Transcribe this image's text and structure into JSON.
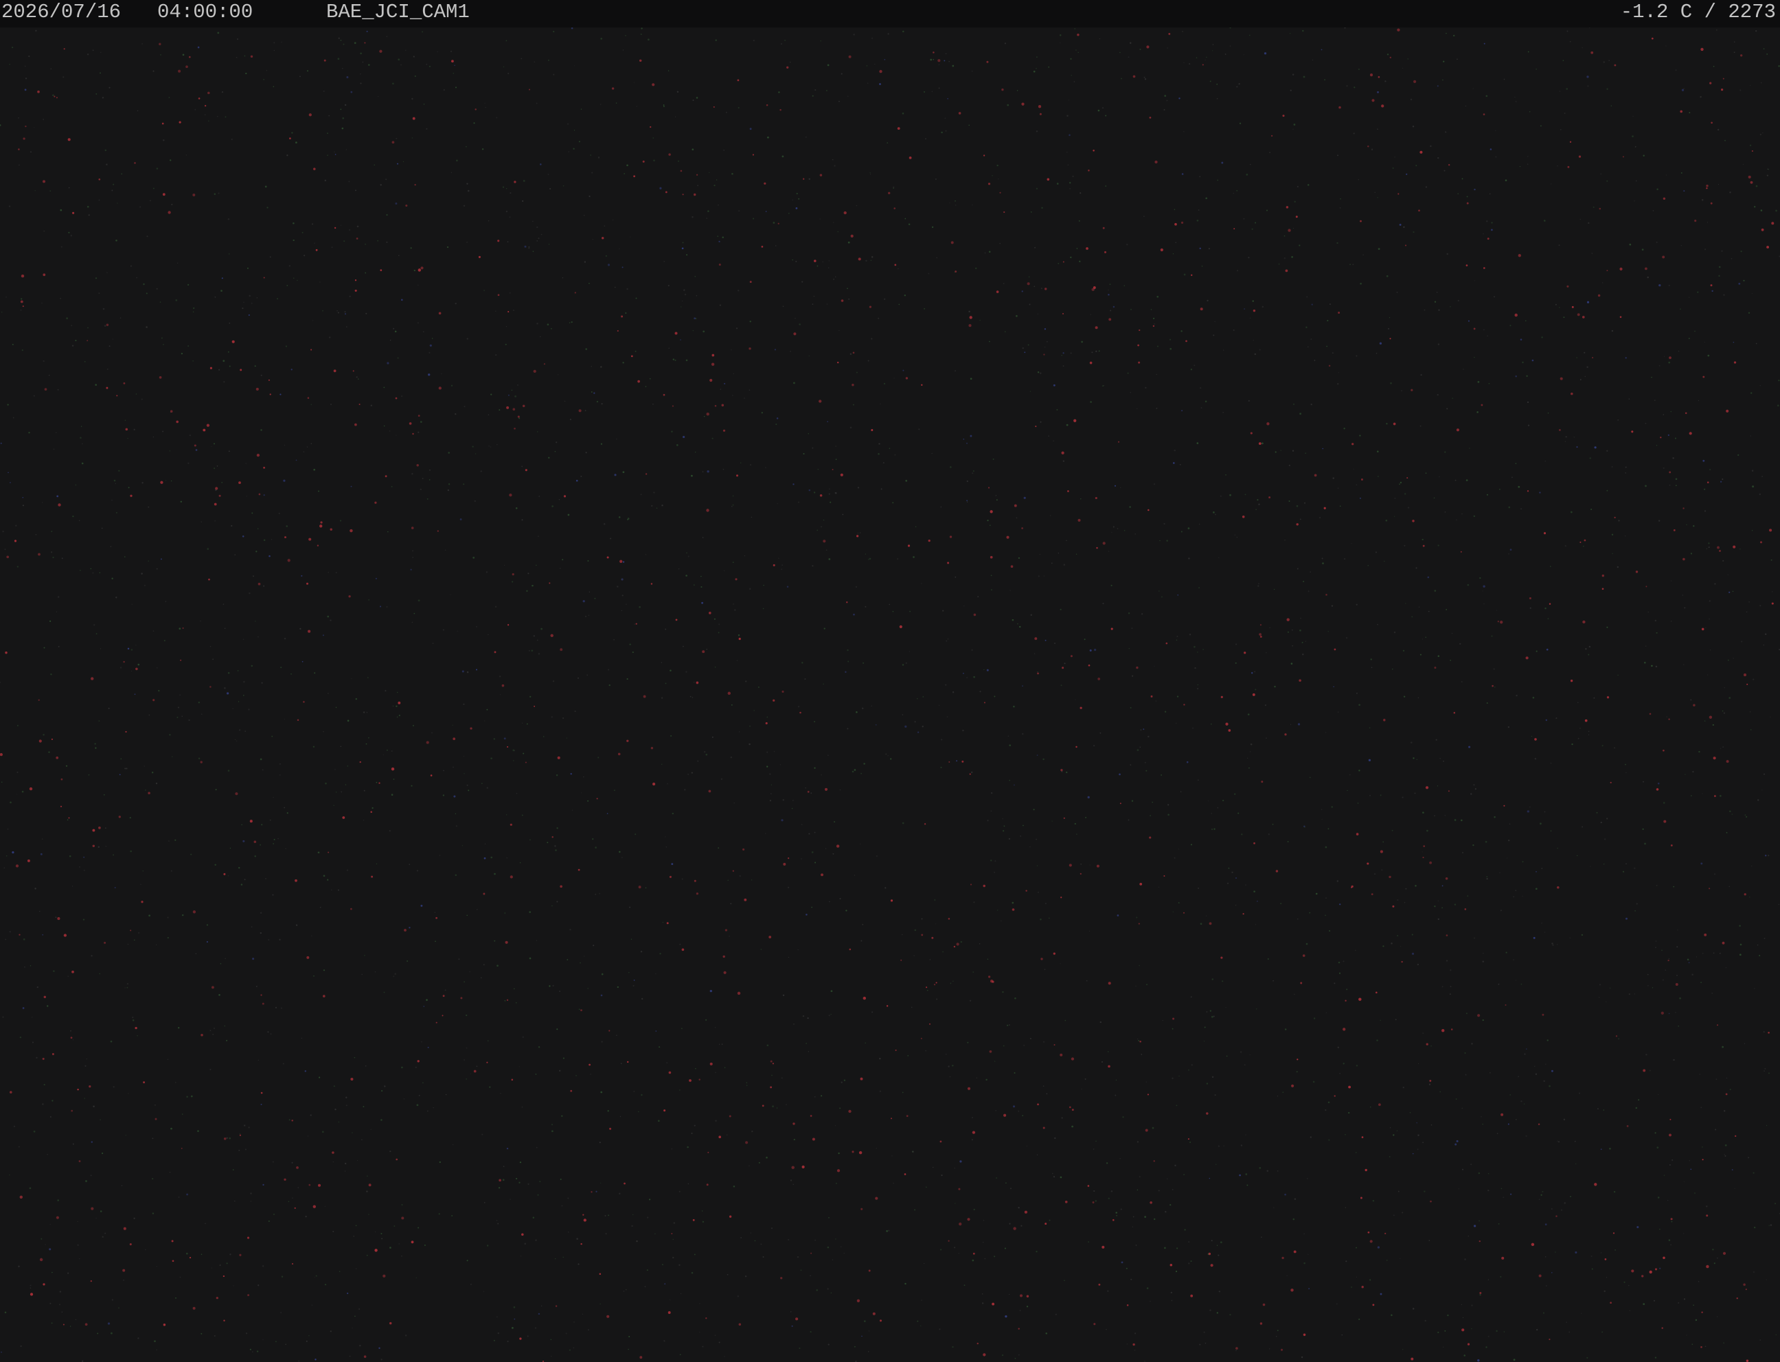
{
  "overlay": {
    "date": "2026/07/16",
    "time": "04:00:00",
    "camera_name": "BAE_JCI_CAM1",
    "readout": "-1.2 C / 2273"
  },
  "colors": {
    "background": "#151516",
    "overlay_bar": "#0d0d0e",
    "overlay_text": "#c4c4c4",
    "noise_red": "#b8323c",
    "noise_green": "#3a6a3a",
    "noise_blue": "#3a4aa0",
    "noise_grey": "#4a4a4a"
  }
}
